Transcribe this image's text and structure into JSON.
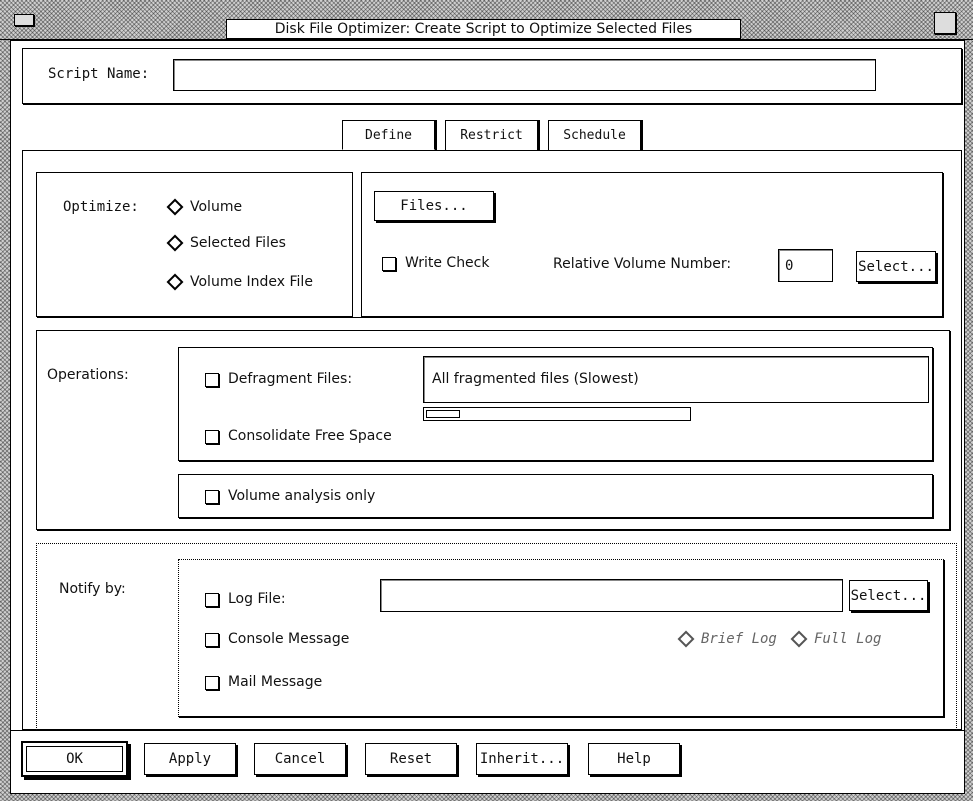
{
  "window": {
    "title": "Disk File Optimizer: Create Script to Optimize Selected Files"
  },
  "script_name": {
    "label": "Script Name:",
    "value": ""
  },
  "tabs": [
    {
      "label": "Define",
      "active": true
    },
    {
      "label": "Restrict",
      "active": false
    },
    {
      "label": "Schedule",
      "active": false
    }
  ],
  "optimize": {
    "label": "Optimize:",
    "options": [
      {
        "label": "Volume"
      },
      {
        "label": "Selected Files"
      },
      {
        "label": "Volume Index File"
      }
    ],
    "files_button": "Files...",
    "write_check": "Write Check",
    "relative_volume_label": "Relative Volume Number:",
    "relative_volume_value": "0",
    "select_button": "Select..."
  },
  "operations": {
    "label": "Operations:",
    "defragment": "Defragment Files:",
    "defragment_option": "All fragmented files (Slowest)",
    "consolidate": "Consolidate Free Space",
    "volume_analysis": "Volume analysis only"
  },
  "notify": {
    "label": "Notify by:",
    "log_file": "Log File:",
    "log_file_value": "",
    "select_button": "Select...",
    "console_message": "Console Message",
    "brief_log": "Brief Log",
    "full_log": "Full Log",
    "mail_message": "Mail Message"
  },
  "footer": {
    "ok": "OK",
    "apply": "Apply",
    "cancel": "Cancel",
    "reset": "Reset",
    "inherit": "Inherit...",
    "help": "Help"
  }
}
